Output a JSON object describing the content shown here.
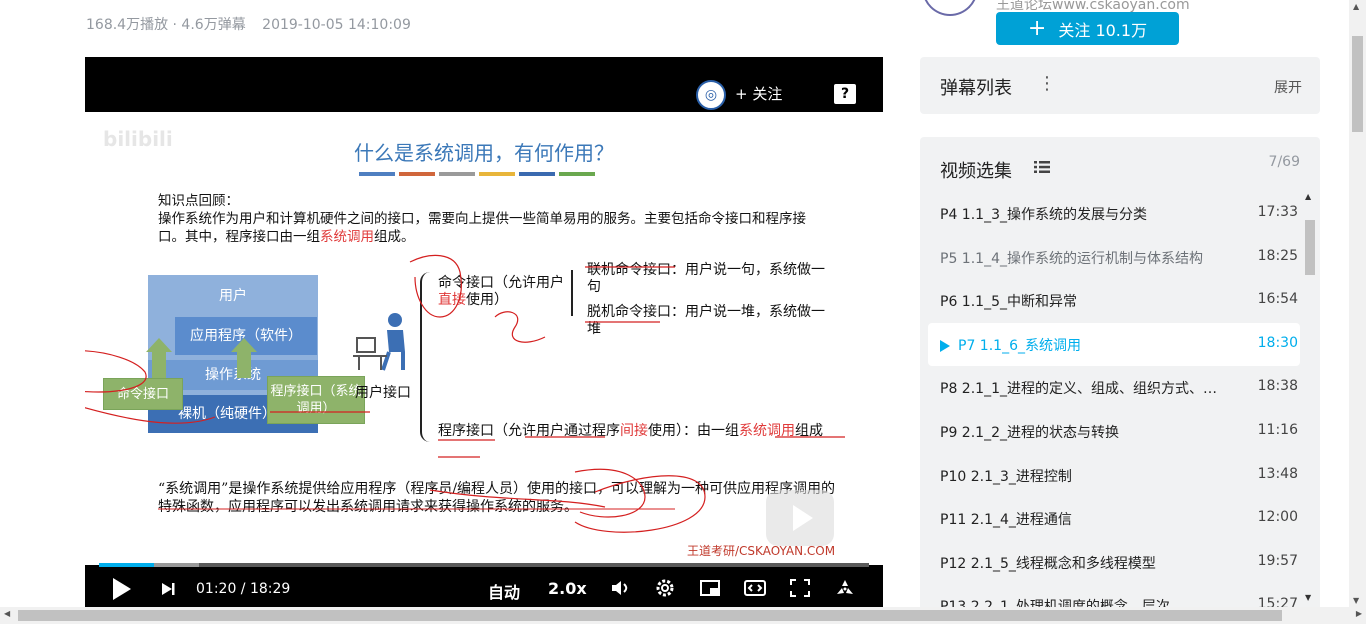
{
  "video_meta": {
    "plays": "168.4万播放 · 4.6万弹幕",
    "date": "2019-10-05 14:10:09"
  },
  "player": {
    "follow_label": "+ 关注",
    "help_glyph": "?",
    "slide": {
      "logo_watermark": "bilibili",
      "title": "什么是系统调用，有何作用？",
      "title_bar_colors": [
        "#4f7fc1",
        "#d0663b",
        "#9a9a9a",
        "#e8b53a",
        "#3a6ab0",
        "#6aa84f"
      ],
      "recall_heading": "知识点回顾：",
      "recall_body_a": "操作系统作为用户和计算机硬件之间的接口，需要向上提供一些简单易用的服务。主要包括命令接口和程序接口。其中，程序接口由一组",
      "recall_body_red": "系统调用",
      "recall_body_b": "组成。",
      "user_label": "用户",
      "app_label": "应用程序（软件）",
      "os_label": "操作系统",
      "bare_label": "裸机（纯硬件）",
      "cmd_green": "命令接口",
      "prog_green": "程序接口（系统调用）",
      "user_iface": "用户接口",
      "cmd_iface_a": "命令接口（允许用户",
      "cmd_iface_red": "直接",
      "cmd_iface_b": "使用）",
      "online": "联机命令接口：用户说一句，系统做一句",
      "offline": "脱机命令接口：用户说一堆，系统做一堆",
      "prog_iface_a": "程序接口（允许用户通过程序",
      "prog_iface_red1": "间接",
      "prog_iface_b": "使用）：由一组",
      "prog_iface_red2": "系统调用",
      "prog_iface_c": "组成",
      "definition": "“系统调用”是操作系统提供给应用程序（程序员/编程人员）使用的接口，可以理解为一种可供应用程序调用的特殊函数，应用程序可以发出系统调用请求来获得操作系统的服务。",
      "watermark": "王道考研/CSKAOYAN.COM"
    },
    "progress": 0.072,
    "buffered": 0.13,
    "time_current": "01:20",
    "time_sep": " / ",
    "time_total": "18:29",
    "auto_label": "自动",
    "speed_label": "2.0x"
  },
  "up": {
    "name_partial": "王道论坛www.cskaoyan.com",
    "follow_label": "关注 10.1万"
  },
  "danmaku": {
    "title": "弹幕列表",
    "menu_glyph": "⋮",
    "expand": "展开"
  },
  "episodes": {
    "title": "视频选集",
    "count": "7/69",
    "items": [
      {
        "p": "P4  1.1_3_操作系统的发展与分类",
        "d": "17:33",
        "state": "normal"
      },
      {
        "p": "P5  1.1_4_操作系统的运行机制与体系结构",
        "d": "18:25",
        "state": "dim"
      },
      {
        "p": "P6  1.1_5_中断和异常",
        "d": "16:54",
        "state": "normal"
      },
      {
        "p": "P7  1.1_6_系统调用",
        "d": "18:30",
        "state": "active"
      },
      {
        "p": "P8  2.1_1_进程的定义、组成、组织方式、…",
        "d": "18:38",
        "state": "normal"
      },
      {
        "p": "P9  2.1_2_进程的状态与转换",
        "d": "11:16",
        "state": "normal"
      },
      {
        "p": "P10  2.1_3_进程控制",
        "d": "13:48",
        "state": "normal"
      },
      {
        "p": "P11  2.1_4_进程通信",
        "d": "12:00",
        "state": "normal"
      },
      {
        "p": "P12  2.1_5_线程概念和多线程模型",
        "d": "19:57",
        "state": "normal"
      },
      {
        "p": "P13  2.2_1_处理机调度的概念、层次",
        "d": "15:27",
        "state": "normal"
      }
    ]
  }
}
